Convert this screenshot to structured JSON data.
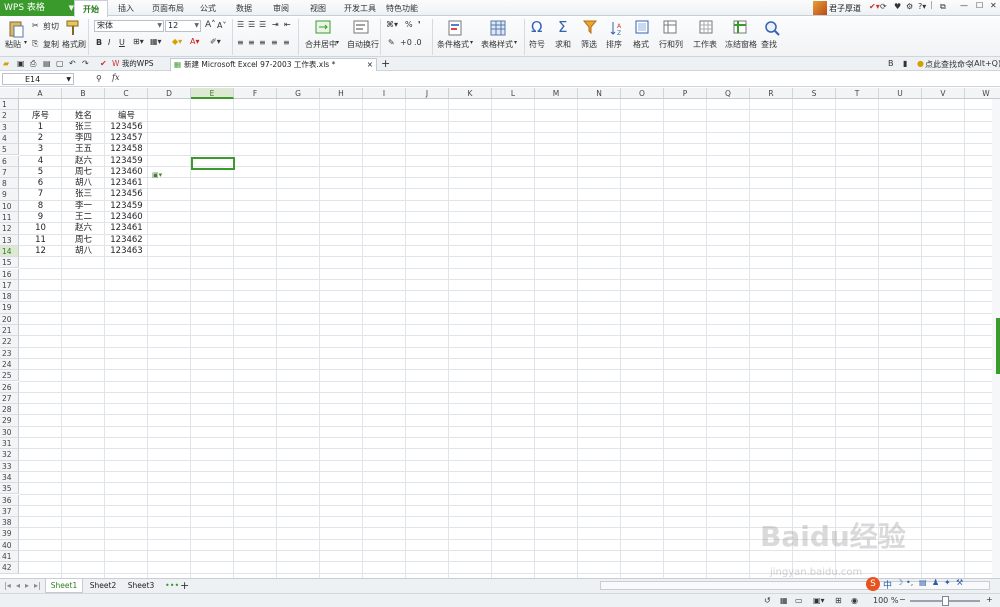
{
  "app": {
    "title": "WPS 表格"
  },
  "menu": {
    "tabs": [
      "开始",
      "插入",
      "页面布局",
      "公式",
      "数据",
      "审阅",
      "视图",
      "开发工具",
      "特色功能"
    ],
    "active": "开始"
  },
  "user": {
    "name": "君子厚道"
  },
  "ribbon": {
    "paste": "粘贴",
    "cut": "剪切",
    "copy": "复制",
    "format_painter": "格式刷",
    "font_name": "宋体",
    "font_size": "12",
    "merge_center": "合并居中",
    "wrap_text": "自动换行",
    "percent": "%",
    "conditional_format": "条件格式",
    "table_style": "表格样式",
    "symbol": "符号",
    "sum": "求和",
    "filter": "筛选",
    "sort": "排序",
    "format": "格式",
    "row_col": "行和列",
    "worksheet": "工作表",
    "freeze": "冻结窗格",
    "find": "查找"
  },
  "docbar": {
    "tab1": "我的WPS",
    "tab2": "新建 Microsoft Excel 97-2003 工作表.xls *",
    "close": "×",
    "add": "+",
    "command_search": "点此查找命令",
    "alt_hint": "(Alt+Q)"
  },
  "formula_bar": {
    "name_box": "E14",
    "fx": "fx"
  },
  "grid": {
    "columns": [
      "A",
      "B",
      "C",
      "D",
      "E",
      "F",
      "G",
      "H",
      "I",
      "J",
      "K",
      "L",
      "M",
      "N",
      "O",
      "P",
      "Q",
      "R",
      "S",
      "T",
      "U",
      "V",
      "W"
    ],
    "active_column": "E",
    "active_row": 14,
    "row_count": 42,
    "header": [
      "序号",
      "姓名",
      "编号"
    ],
    "rows": [
      [
        "1",
        "张三",
        "123456"
      ],
      [
        "2",
        "李四",
        "123457"
      ],
      [
        "3",
        "王五",
        "123458"
      ],
      [
        "4",
        "赵六",
        "123459"
      ],
      [
        "5",
        "周七",
        "123460"
      ],
      [
        "6",
        "胡八",
        "123461"
      ],
      [
        "7",
        "张三",
        "123456"
      ],
      [
        "8",
        "李一",
        "123459"
      ],
      [
        "9",
        "王二",
        "123460"
      ],
      [
        "10",
        "赵六",
        "123461"
      ],
      [
        "11",
        "周七",
        "123462"
      ],
      [
        "12",
        "胡八",
        "123463"
      ]
    ]
  },
  "sheets": [
    "Sheet1",
    "Sheet2",
    "Sheet3"
  ],
  "active_sheet": "Sheet1",
  "status": {
    "zoom": "100 %"
  },
  "watermark": {
    "text": "Baidu经验",
    "url": "jingyan.baidu.com"
  },
  "colors": {
    "accent": "#3a9b2c",
    "grid_line": "#e1e4e8",
    "header_bg": "#f2f4f6"
  }
}
